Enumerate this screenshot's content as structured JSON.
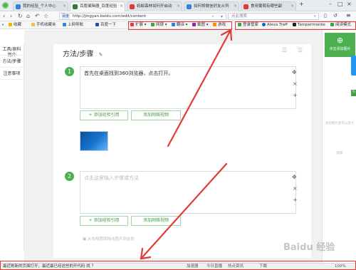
{
  "tabs": [
    {
      "label": "我的经验_个人中心",
      "color": "#3b82d6",
      "active": false
    },
    {
      "label": "百度编辑器_百度经验",
      "color": "#2e7d32",
      "active": true
    },
    {
      "label": "蚂蚁森林如何开启动",
      "color": "#e53935",
      "active": false
    },
    {
      "label": "如何将微信好友从列",
      "color": "#3b82d6",
      "active": false
    },
    {
      "label": "食用葡萄有哪些副",
      "color": "#e53935",
      "active": false
    }
  ],
  "address": {
    "badge": "百度",
    "url": "http://jingyan.baidu.com/edit/content",
    "search_placeholder": "点此搜索"
  },
  "bookmarks": {
    "left": [
      "收藏",
      "手机收藏夹",
      "上网导航",
      "百度一下"
    ],
    "extensions": [
      "扩展",
      "网银",
      "翻译",
      "截图",
      "游戏"
    ],
    "right": [
      "登录管家",
      "Alexa Traff",
      "Tampermonke",
      "阅读模式"
    ]
  },
  "leftnav": [
    "简介",
    "工具/原料",
    "方法/步骤",
    "注意事项"
  ],
  "main": {
    "title": "方法/步骤",
    "step1": {
      "num": "1",
      "text": "首先在桌面找到360浏览器，点击打开。"
    },
    "step2": {
      "num": "2",
      "placeholder": "点击这里输入步骤或方法"
    },
    "add_exp_ref": "+ 添加经验引用",
    "add_video": "添加网络视频",
    "upload_hint": "从右侧图库拖动图片到此处"
  },
  "rightpanel": {
    "add_image": "点击添加图片",
    "image_lib_empty": "添加图片后可以放大",
    "hint": "图库"
  },
  "status": {
    "left": "最近刷新的页面打开，最近最已经这些的开代码 找 ？",
    "items": [
      "加速器",
      "今日直播",
      "热点资讯",
      "下载"
    ],
    "zoom": "100%"
  },
  "watermark": "Baidu 经验",
  "colors": {
    "accent": "#4caf50",
    "annotation": "#e53935",
    "link": "#2155a3"
  }
}
